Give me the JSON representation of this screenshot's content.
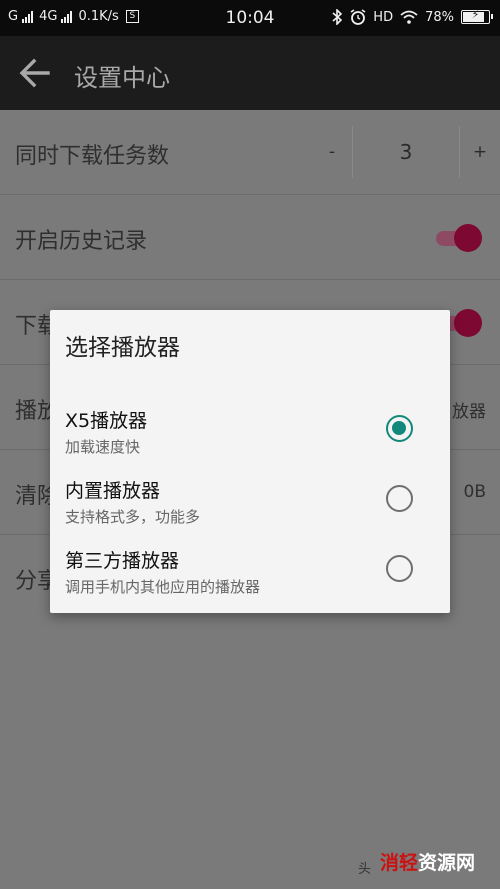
{
  "status_bar": {
    "carrier1": "G",
    "carrier2": "4G",
    "network_speed": "0.1K/s",
    "s_badge": "S",
    "time": "10:04",
    "hd": "HD",
    "battery_percent": "78%"
  },
  "app_bar": {
    "back_icon": "arrow-left-icon",
    "title": "设置中心"
  },
  "settings": [
    {
      "label": "同时下载任务数",
      "control": "stepper",
      "minus": "-",
      "value": "3",
      "plus": "+"
    },
    {
      "label": "开启历史记录",
      "control": "toggle",
      "on": true
    },
    {
      "label": "下载",
      "control": "toggle",
      "on": true
    },
    {
      "label": "播放",
      "control": "value",
      "value": "放器"
    },
    {
      "label": "清除",
      "control": "value",
      "value": "0B"
    },
    {
      "label": "分享",
      "control": "none"
    }
  ],
  "dialog": {
    "title": "选择播放器",
    "options": [
      {
        "title": "X5播放器",
        "subtitle": "加载速度快",
        "selected": true
      },
      {
        "title": "内置播放器",
        "subtitle": "支持格式多，功能多",
        "selected": false
      },
      {
        "title": "第三方播放器",
        "subtitle": "调用手机内其他应用的播放器",
        "selected": false
      }
    ]
  },
  "watermark": {
    "small_text": "头",
    "logo_red": "消轻",
    "logo_white": "资源网"
  },
  "colors": {
    "accent_radio": "#12887a",
    "toggle_on": "#7d0831"
  }
}
